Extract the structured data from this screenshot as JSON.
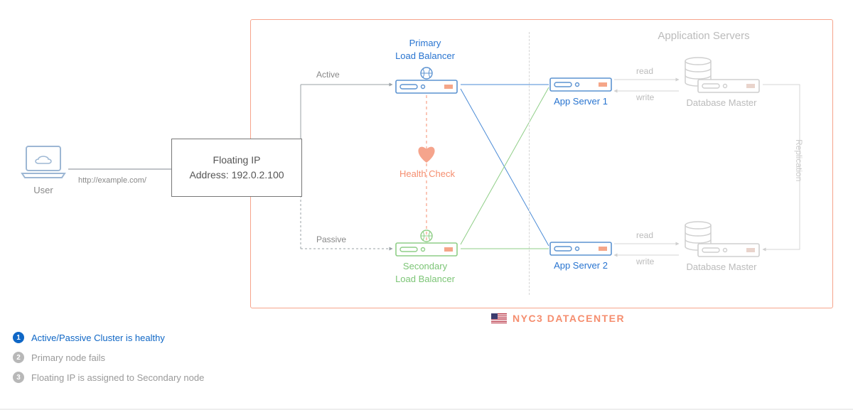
{
  "user": {
    "label": "User",
    "url": "http://example.com/"
  },
  "floating_ip": {
    "line1": "Floating IP",
    "line2": "Address: 192.0.2.100"
  },
  "edges": {
    "active": "Active",
    "passive": "Passive",
    "health_check": "Health Check",
    "read": "read",
    "write": "write",
    "replication": "Replication"
  },
  "load_balancers": {
    "primary": {
      "title1": "Primary",
      "title2": "Load Balancer"
    },
    "secondary": {
      "title1": "Secondary",
      "title2": "Load Balancer"
    }
  },
  "app_servers": {
    "group_title": "Application Servers",
    "server1": "App Server 1",
    "server2": "App Server 2"
  },
  "databases": {
    "master1": "Database Master",
    "master2": "Database Master"
  },
  "datacenter": {
    "name": "NYC3 DATACENTER"
  },
  "legend": {
    "items": [
      {
        "num": "1",
        "text": "Active/Passive Cluster is healthy",
        "active": true
      },
      {
        "num": "2",
        "text": "Primary node fails",
        "active": false
      },
      {
        "num": "3",
        "text": "Floating IP is assigned to Secondary node",
        "active": false
      }
    ]
  }
}
